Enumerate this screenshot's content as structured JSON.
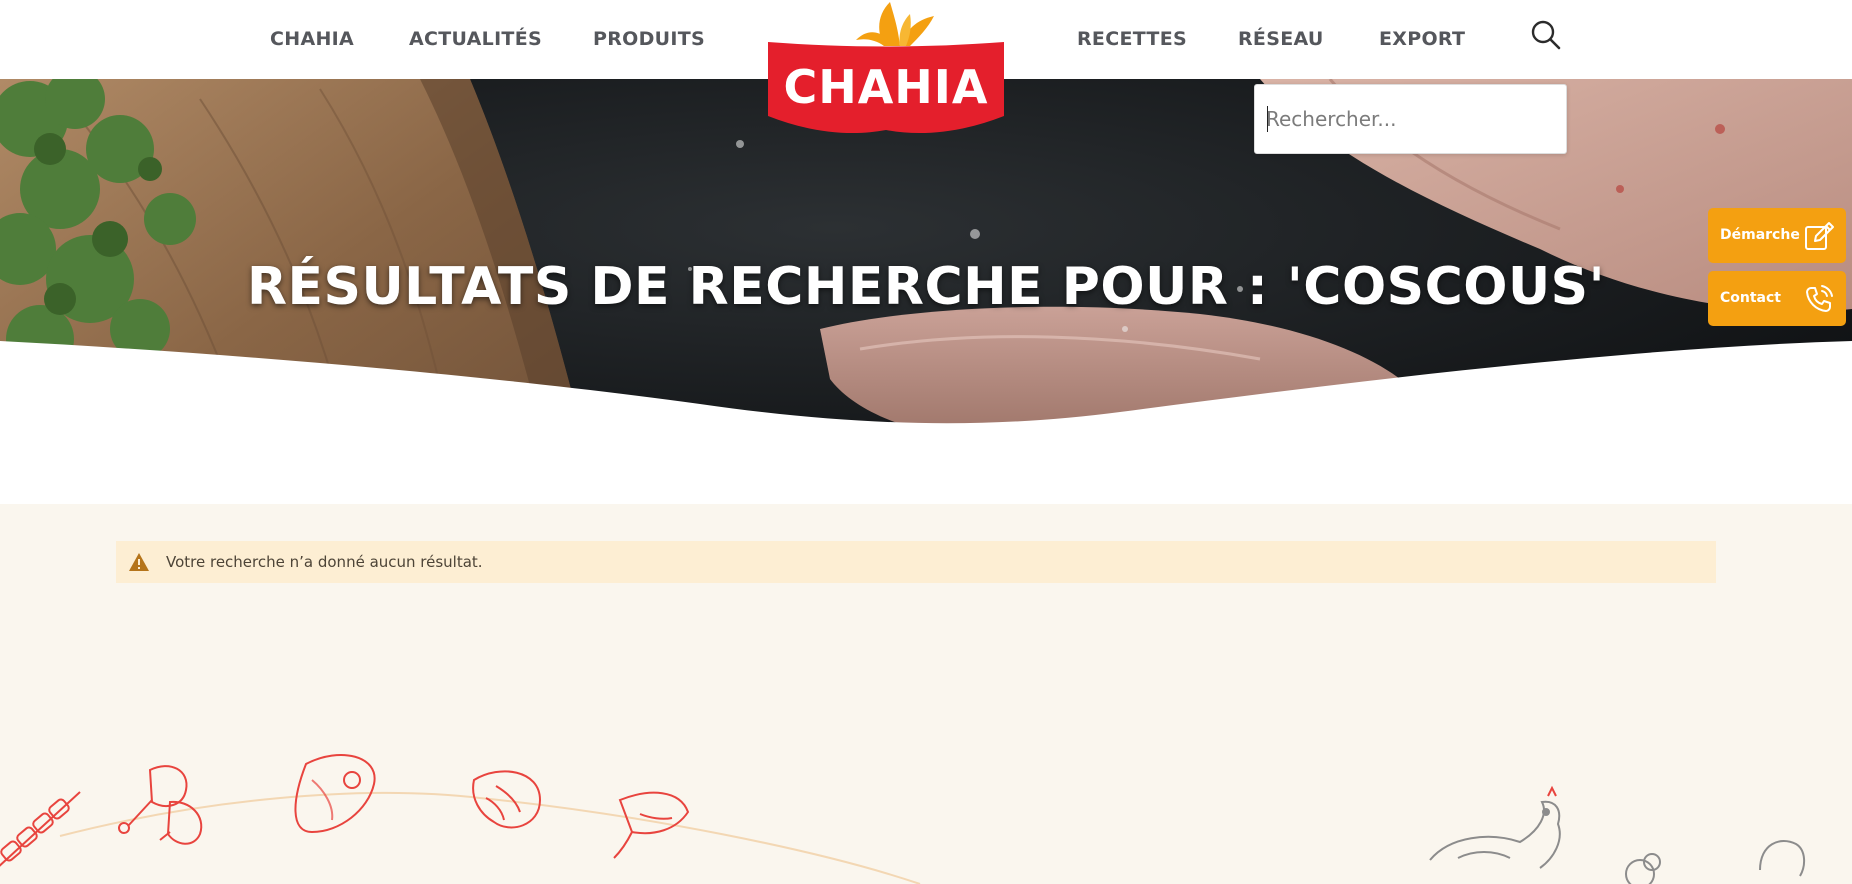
{
  "header": {
    "nav_left": [
      {
        "label": "CHAHIA"
      },
      {
        "label": "ACTUALITÉS"
      },
      {
        "label": "PRODUITS"
      }
    ],
    "nav_right": [
      {
        "label": "RECETTES"
      },
      {
        "label": "RÉSEAU"
      },
      {
        "label": "EXPORT"
      }
    ],
    "logo_text": "CHAHIA",
    "search_icon": "search-icon"
  },
  "search": {
    "placeholder": "Rechercher...",
    "value": ""
  },
  "hero": {
    "title": "RÉSULTATS DE RECHERCHE POUR : 'COSCOUS'"
  },
  "side_buttons": [
    {
      "label": "Démarche",
      "icon": "edit-icon"
    },
    {
      "label": "Contact",
      "icon": "phone-icon"
    }
  ],
  "notice": {
    "icon": "warning-icon",
    "text": "Votre recherche n’a donné aucun résultat."
  },
  "colors": {
    "brand_red": "#e41f2c",
    "brand_orange": "#f4a011",
    "nav_text": "#55575c",
    "page_bg": "#faf6ee",
    "notice_bg": "#fdeed3",
    "illustration": "#e8443e"
  }
}
